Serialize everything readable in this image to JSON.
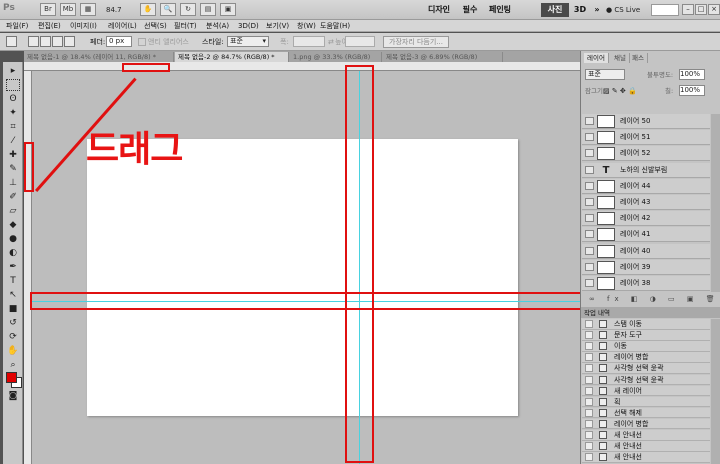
{
  "app": {
    "logo": "Ps",
    "zoom": "84.7",
    "workspaces": [
      "디자인",
      "필수",
      "페인팅",
      "사진"
    ],
    "active_workspace": "사진",
    "three_d": "3D",
    "cs_live": "CS Live"
  },
  "menu": [
    "파일(F)",
    "편집(E)",
    "이미지(I)",
    "레이어(L)",
    "선택(S)",
    "필터(T)",
    "분석(A)",
    "3D(D)",
    "보기(V)",
    "창(W)",
    "도움말(H)"
  ],
  "options": {
    "feather_label": "페더:",
    "feather_value": "0 px",
    "antialias": "앤티 앨리어스",
    "style_label": "스타일:",
    "style_value": "표준",
    "width_label": "폭:",
    "height_label": "높이:",
    "refine_button": "가장자리 다듬기..."
  },
  "tabs": [
    "제목 없음-1 @ 18.4% (레이어 11, RGB/8) *",
    "제목 없음-2 @ 84.7% (RGB/8) *",
    "1.png @ 33.3% (RGB/8)",
    "제목 없음-3 @ 6.89% (RGB/8)"
  ],
  "annotation": {
    "drag_label": "드래그"
  },
  "layers_panel": {
    "tabs": [
      "레이어",
      "채널",
      "패스"
    ],
    "blend_mode": "표준",
    "opacity_label": "불투명도:",
    "opacity_value": "100%",
    "lock_label": "잠그기:",
    "fill_label": "칠:",
    "fill_value": "100%",
    "layers": [
      {
        "name": "레이어 50",
        "type": "image"
      },
      {
        "name": "레이어 51",
        "type": "image"
      },
      {
        "name": "레이어 52",
        "type": "image"
      },
      {
        "name": "노하의 신발부림",
        "type": "text"
      },
      {
        "name": "레이어 44",
        "type": "image"
      },
      {
        "name": "레이어 43",
        "type": "image"
      },
      {
        "name": "레이어 42",
        "type": "image"
      },
      {
        "name": "레이어 41",
        "type": "image"
      },
      {
        "name": "레이어 40",
        "type": "image"
      },
      {
        "name": "레이어 39",
        "type": "image"
      },
      {
        "name": "레이어 38",
        "type": "image"
      }
    ]
  },
  "history_panel": {
    "title": "작업 내역",
    "items": [
      "스탬 이동",
      "문자 도구",
      "이동",
      "레이어 병합",
      "사각형 선택 윤곽",
      "사각형 선택 윤곽",
      "새 레이어",
      "획",
      "선택 해제",
      "레이어 병합",
      "새 안내선",
      "새 안내선",
      "새 안내선"
    ]
  },
  "colors": {
    "highlight": "#e01010",
    "guide": "#48d2e0",
    "foreground": "#e00000",
    "background": "#ffffff"
  }
}
